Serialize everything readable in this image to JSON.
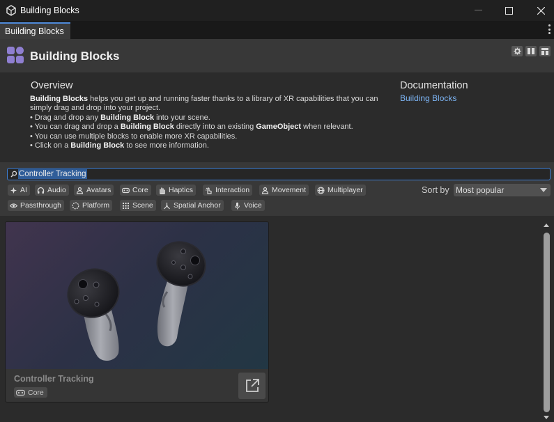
{
  "window": {
    "title": "Building Blocks"
  },
  "tab": {
    "label": "Building Blocks"
  },
  "header": {
    "title": "Building Blocks"
  },
  "overview": {
    "heading": "Overview",
    "intro_bold": "Building Blocks",
    "intro_rest": " helps you get up and running faster thanks to a library of XR capabilities that you can simply drag and drop into your project.",
    "b1_pre": "• Drag and drop any ",
    "b1_bold": "Building Block",
    "b1_post": " into your scene.",
    "b2_pre": "• You can drag and drop a ",
    "b2_bold": "Building Block",
    "b2_mid": " directly into an existing ",
    "b2_bold2": "GameObject",
    "b2_post": " when relevant.",
    "b3": "• You can use multiple blocks to enable more XR capabilities.",
    "b4_pre": "• Click on a ",
    "b4_bold": "Building Block",
    "b4_post": " to see more information."
  },
  "documentation": {
    "heading": "Documentation",
    "link": "Building Blocks"
  },
  "search": {
    "value": "Controller Tracking"
  },
  "tags": [
    "AI",
    "Audio",
    "Avatars",
    "Core",
    "Haptics",
    "Interaction",
    "Movement",
    "Multiplayer",
    "Passthrough",
    "Platform",
    "Scene",
    "Spatial Anchor",
    "Voice"
  ],
  "sort": {
    "label": "Sort by",
    "value": "Most popular"
  },
  "results": [
    {
      "title": "Controller Tracking",
      "tag": "Core"
    }
  ],
  "colors": {
    "accent": "#3d7fd6",
    "link": "#7db5f5",
    "logo": "#8f7fd1"
  },
  "icons": [
    "window-app-icon",
    "minimize-icon",
    "maximize-icon",
    "close-icon",
    "settings-gear-icon",
    "layout-columns-icon",
    "layout-panel-icon",
    "search-icon",
    "open-external-icon"
  ]
}
